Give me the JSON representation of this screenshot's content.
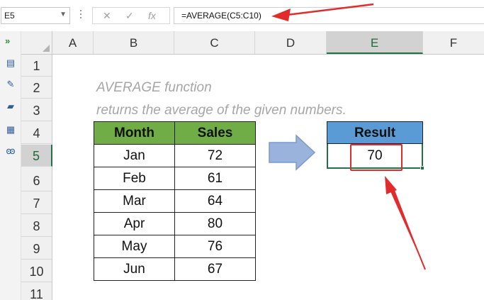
{
  "formula_bar": {
    "name_box": "E5",
    "formula": "=AVERAGE(C5:C10)",
    "cancel_icon": "✕",
    "enter_icon": "✓",
    "fx_icon": "fx"
  },
  "columns": [
    "A",
    "B",
    "C",
    "D",
    "E",
    "F"
  ],
  "selected_column": "E",
  "rows": [
    "1",
    "2",
    "3",
    "4",
    "5",
    "6",
    "7",
    "8",
    "9",
    "10",
    "11"
  ],
  "selected_row": "5",
  "caption": {
    "line1": "AVERAGE function",
    "line2": "returns the average of the given numbers."
  },
  "table": {
    "headers": [
      "Month",
      "Sales"
    ],
    "rows": [
      [
        "Jan",
        "72"
      ],
      [
        "Feb",
        "61"
      ],
      [
        "Mar",
        "64"
      ],
      [
        "Apr",
        "80"
      ],
      [
        "May",
        "76"
      ],
      [
        "Jun",
        "67"
      ]
    ]
  },
  "result": {
    "header": "Result",
    "value": "70"
  },
  "colors": {
    "table_header": "#70ad47",
    "result_header": "#5b9bd5",
    "selection": "#217346",
    "annotation": "#e22b2b"
  },
  "icons": [
    "chevron-right-icon",
    "keyboard-icon",
    "form-icon",
    "layers-icon",
    "grid-icon",
    "binoculars-icon"
  ]
}
